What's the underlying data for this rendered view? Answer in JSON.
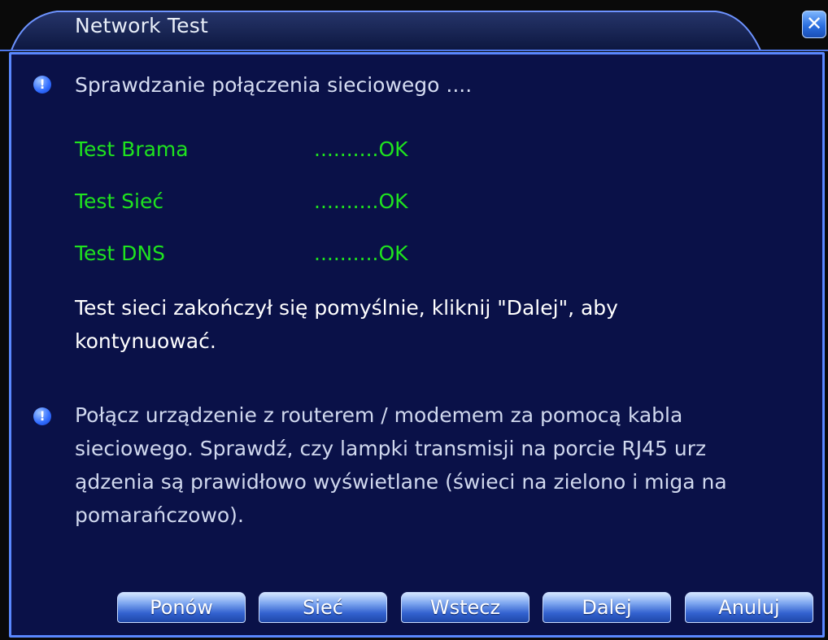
{
  "window": {
    "title": "Network Test",
    "close_symbol": "✕"
  },
  "status": {
    "icon": "info-icon",
    "message": "Sprawdzanie połączenia sieciowego ...."
  },
  "tests": [
    {
      "label": "Test Brama",
      "result": "..........OK"
    },
    {
      "label": "Test Sieć",
      "result": "..........OK"
    },
    {
      "label": "Test DNS",
      "result": "..........OK"
    }
  ],
  "success": {
    "line1": "Test sieci zakończył się pomyślnie, kliknij \"Dalej\", aby",
    "line2": "kontynuować."
  },
  "hint": {
    "icon": "info-icon",
    "line1": "Połącz urządzenie z routerem / modemem za pomocą kabla",
    "line2": "sieciowego. Sprawdź, czy lampki transmisji na porcie RJ45 urz",
    "line3": "ądzenia są prawidłowo wyświetlane (świeci na zielono i miga na",
    "line4": "pomarańczowo)."
  },
  "buttons": {
    "retry": "Ponów",
    "network": "Sieć",
    "back": "Wstecz",
    "next": "Dalej",
    "cancel": "Anuluj"
  },
  "colors": {
    "panel_bg": "#0a1148",
    "panel_border": "#5a88ff",
    "test_label": "#1fe31f",
    "accent": "#2f6bff"
  }
}
